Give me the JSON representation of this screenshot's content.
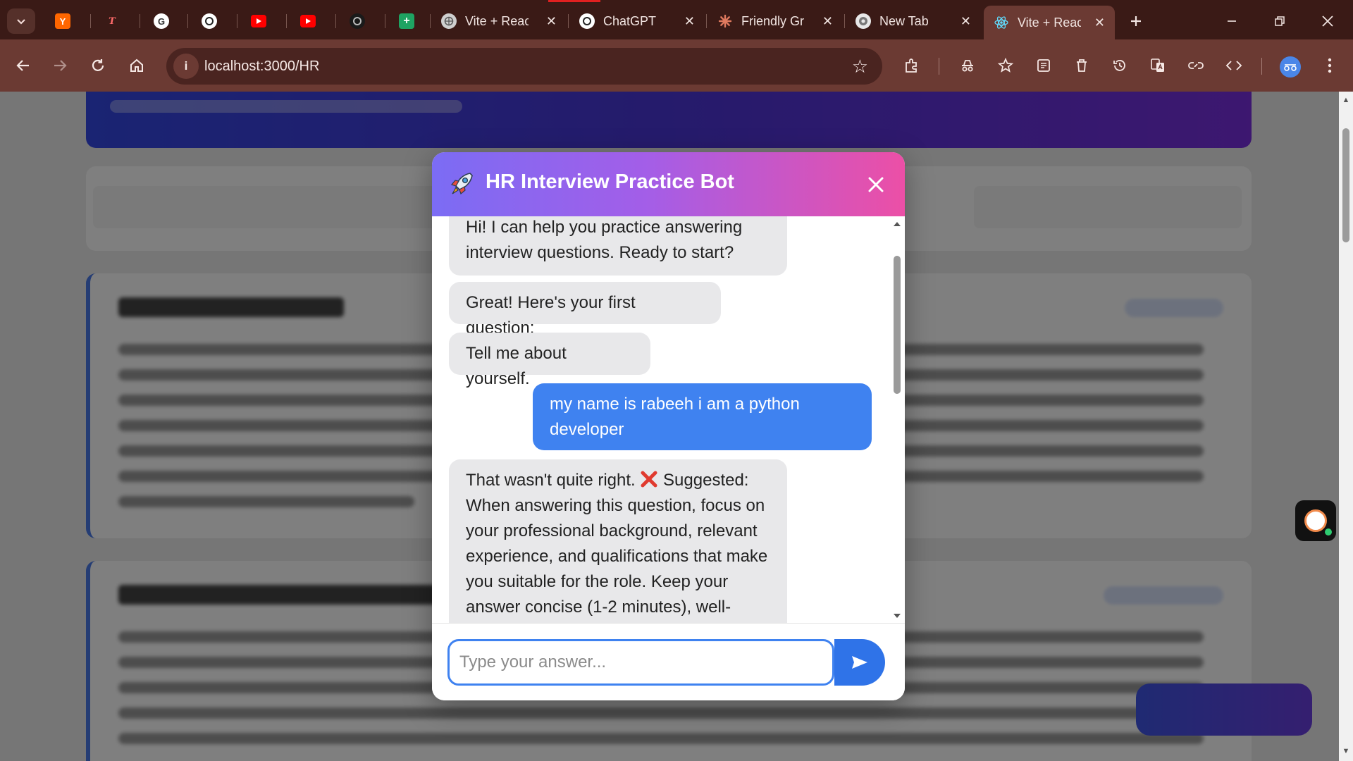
{
  "browser": {
    "tabs": [
      {
        "title": "",
        "favicon": "y-icon",
        "color": "#ff6600"
      },
      {
        "title": "",
        "favicon": "t-icon",
        "color": "#e03a3a"
      },
      {
        "title": "",
        "favicon": "google-icon",
        "color": "#ffffff"
      },
      {
        "title": "",
        "favicon": "openai-icon",
        "color": "#ffffff"
      },
      {
        "title": "",
        "favicon": "youtube-icon",
        "color": "#ff0000"
      },
      {
        "title": "",
        "favicon": "youtube-icon",
        "color": "#ff0000"
      },
      {
        "title": "",
        "favicon": "openai-icon",
        "color": "#222222"
      },
      {
        "title": "",
        "favicon": "sheets-icon",
        "color": "#1ea362"
      },
      {
        "title": "Vite + React",
        "favicon": "globe-icon"
      },
      {
        "title": "ChatGPT",
        "favicon": "openai-icon"
      },
      {
        "title": "Friendly Gr",
        "favicon": "claude-icon"
      },
      {
        "title": "New Tab",
        "favicon": "chrome-icon"
      },
      {
        "title": "Vite + React",
        "favicon": "react-icon",
        "active": true
      }
    ],
    "address": "localhost:3000/HR"
  },
  "modal": {
    "title": "HR Interview Practice Bot",
    "messages": [
      {
        "role": "bot",
        "text": "Hi! I can help you practice answering interview questions. Ready to start?"
      },
      {
        "role": "bot",
        "text": "Great! Here's your first question:"
      },
      {
        "role": "bot",
        "text": "Tell me about yourself."
      },
      {
        "role": "user",
        "text": "my name is rabeeh i am a python developer"
      },
      {
        "role": "bot",
        "text_prefix": "That wasn't quite right. ",
        "text_suffix": " Suggested: When answering this question, focus on your professional background, relevant experience, and qualifications that make you suitable for the role. Keep your answer concise (1-2 minutes), well-"
      }
    ],
    "input": {
      "placeholder": "Type your answer...",
      "value": ""
    },
    "colors": {
      "header_start": "#7b6cf4",
      "header_end": "#ec4fa6",
      "user_bubble": "#3f82f0",
      "bot_bubble": "#e8e8ea"
    }
  }
}
